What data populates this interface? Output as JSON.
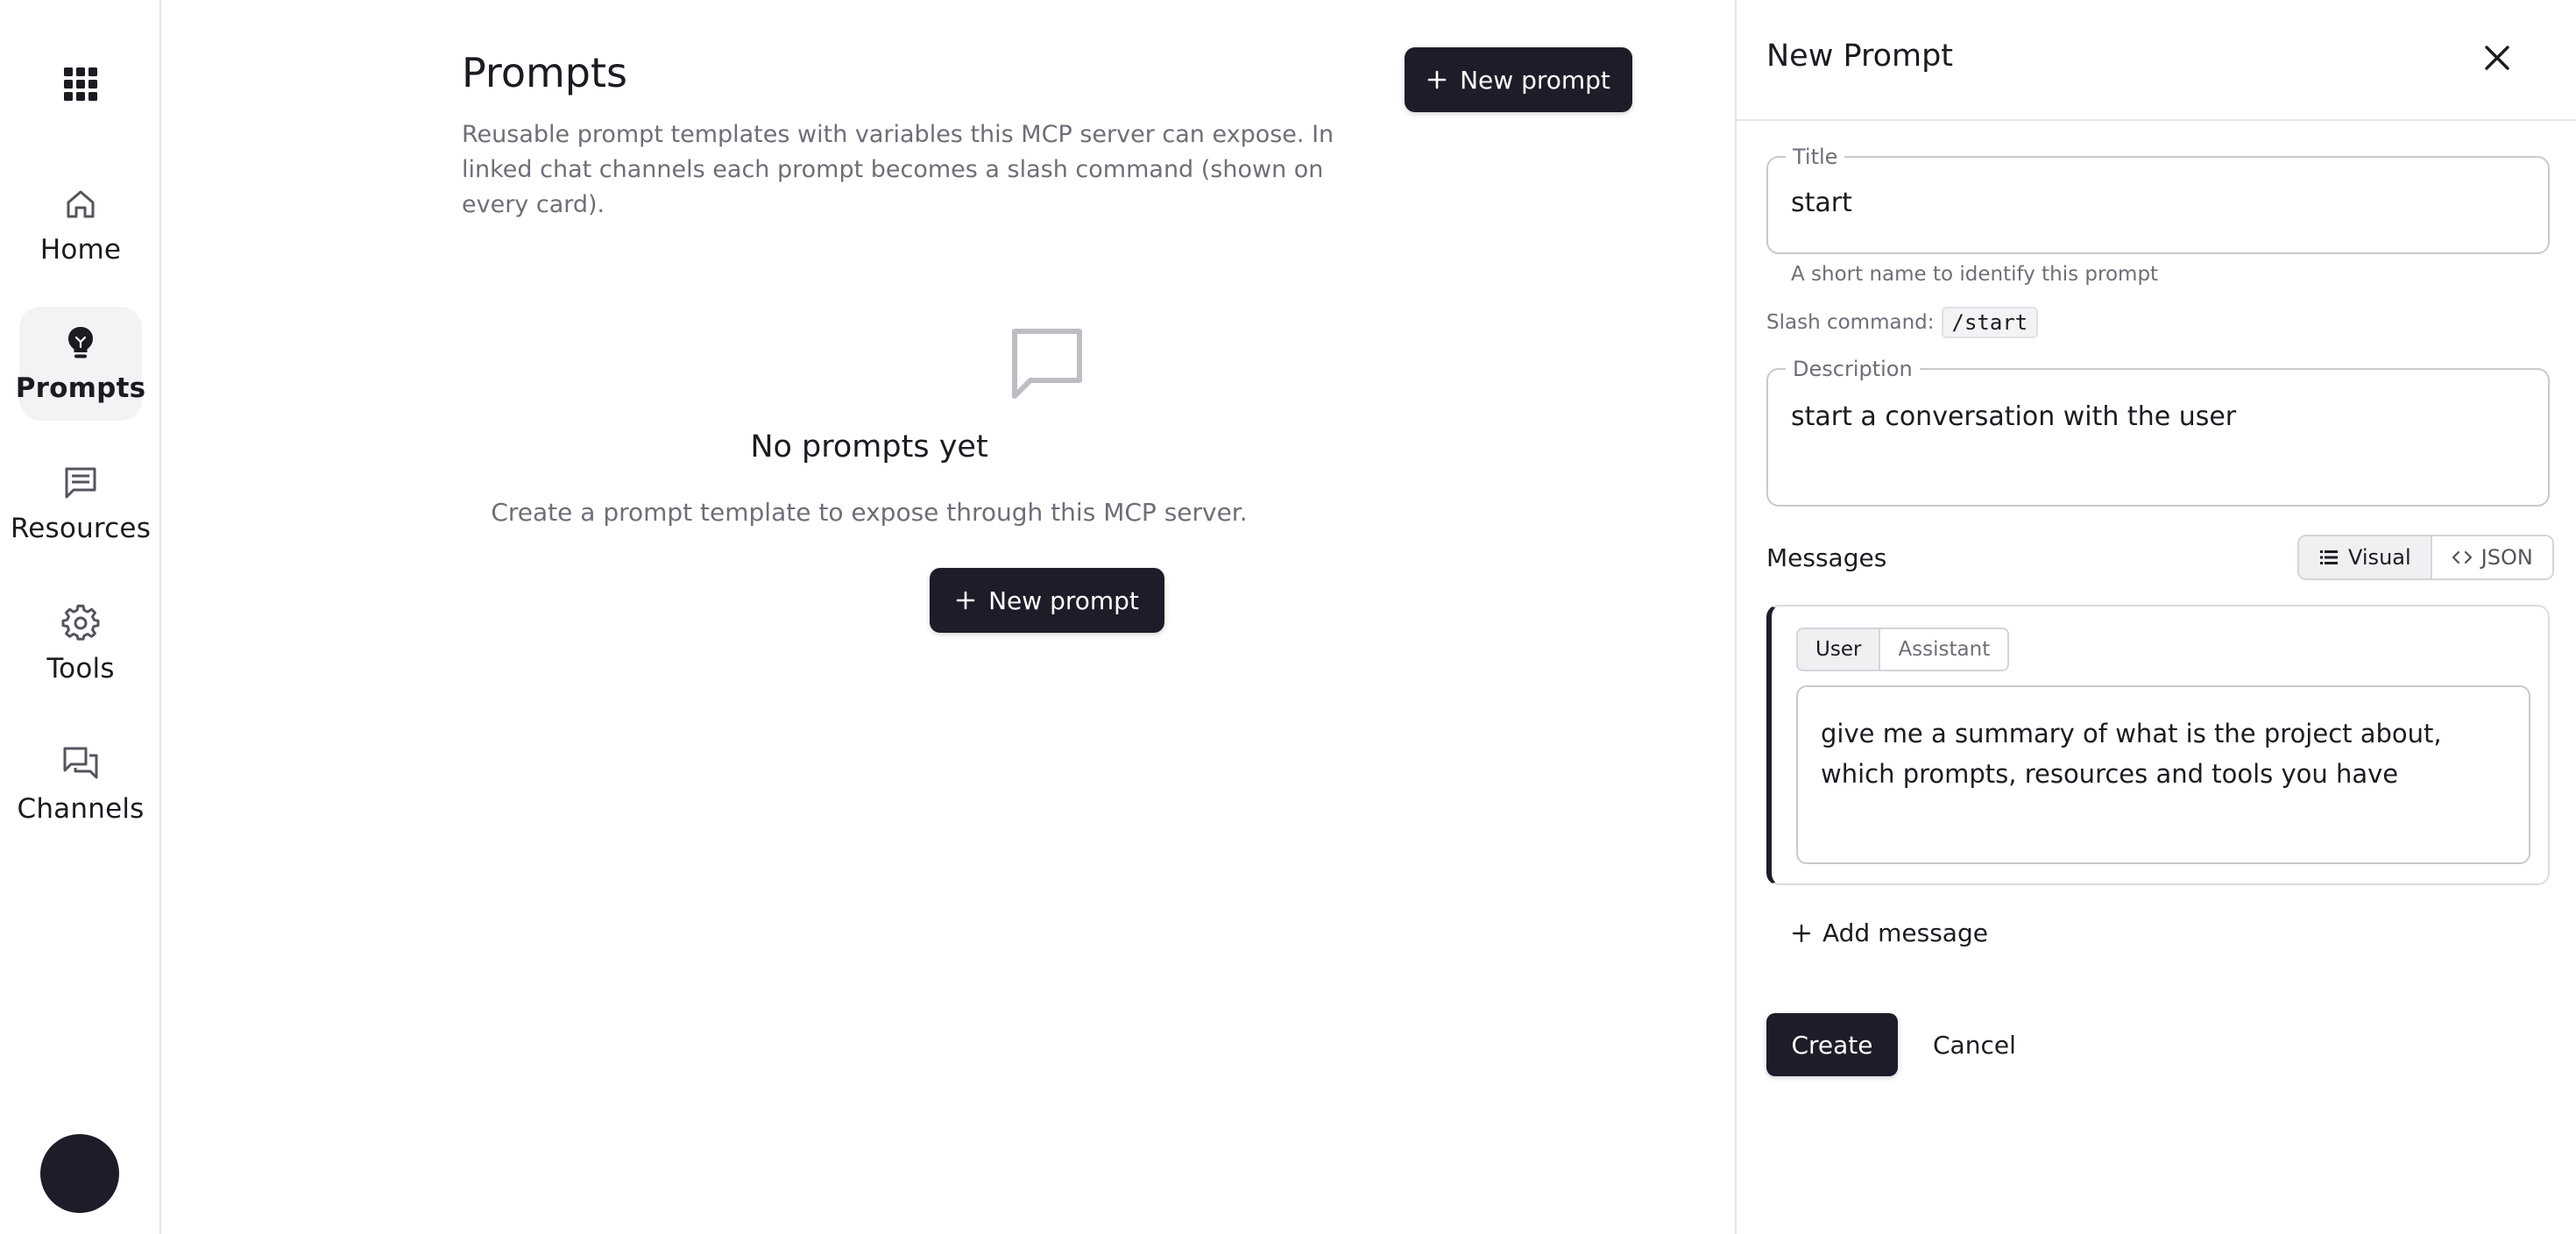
{
  "colors": {
    "primary": "#1e1c28",
    "muted_text": "#6f6e78",
    "border": "#c9c9cf",
    "active_bg": "#f3f3f5"
  },
  "sidebar": {
    "apps_icon": "grid-icon",
    "items": [
      {
        "label": "Home",
        "icon": "home-icon",
        "active": false
      },
      {
        "label": "Prompts",
        "icon": "lightbulb-icon",
        "active": true
      },
      {
        "label": "Resources",
        "icon": "message-square-icon",
        "active": false
      },
      {
        "label": "Tools",
        "icon": "gear-icon",
        "active": false
      },
      {
        "label": "Channels",
        "icon": "chat-bubbles-icon",
        "active": false
      }
    ]
  },
  "main": {
    "title": "Prompts",
    "description": "Reusable prompt templates with variables this MCP server can expose. In linked chat channels each prompt becomes a slash command (shown on every card).",
    "new_prompt_label": "New prompt",
    "empty_state": {
      "icon": "message-square-icon",
      "title": "No prompts yet",
      "subtitle": "Create a prompt template to expose through this MCP server.",
      "button_label": "New prompt"
    }
  },
  "panel": {
    "title": "New Prompt",
    "title_field": {
      "label": "Title",
      "value": "start",
      "helper": "A short name to identify this prompt"
    },
    "slash_command": {
      "label": "Slash command:",
      "value": "/start"
    },
    "description_field": {
      "label": "Description",
      "value": "start a conversation with the user"
    },
    "messages": {
      "label": "Messages",
      "view_modes": [
        {
          "label": "Visual",
          "icon": "list-icon",
          "active": true
        },
        {
          "label": "JSON",
          "icon": "code-icon",
          "active": false
        }
      ],
      "items": [
        {
          "roles": [
            "User",
            "Assistant"
          ],
          "selected_role": "User",
          "content": "give me a summary of what is the project about, which prompts, resources and tools you have"
        }
      ],
      "add_label": "Add message"
    },
    "create_label": "Create",
    "cancel_label": "Cancel"
  }
}
